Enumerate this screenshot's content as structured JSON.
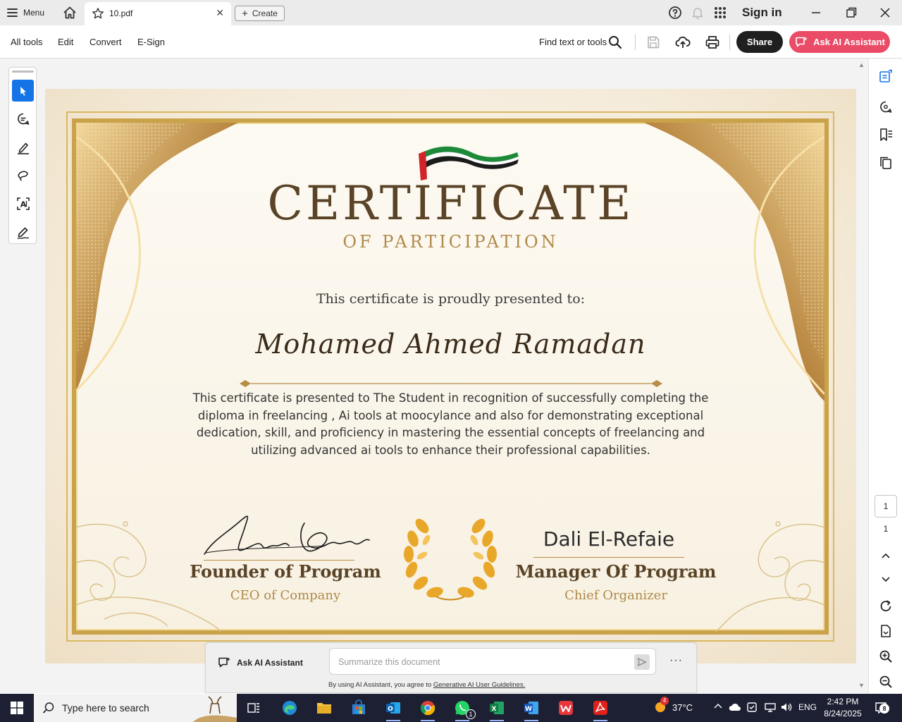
{
  "titlebar": {
    "menu_label": "Menu",
    "tab_name": "10.pdf",
    "tab_close": "✕",
    "create_label": "Create",
    "sign_in": "Sign in"
  },
  "toolbar": {
    "menus": [
      "All tools",
      "Edit",
      "Convert",
      "E-Sign"
    ],
    "find_label": "Find text or tools",
    "share_label": "Share",
    "ai_label": "Ask AI Assistant"
  },
  "certificate": {
    "title": "CERTIFICATE",
    "subtitle": "OF PARTICIPATION",
    "presented_to": "This certificate is proudly presented to:",
    "recipient": "Mohamed Ahmed Ramadan",
    "body": "This certificate is presented to The Student in recognition of successfully completing the diploma in freelancing , Ai tools at moocylance and also for demonstrating exceptional dedication, skill, and proficiency in mastering the essential concepts of freelancing and utilizing advanced ai tools to enhance their professional capabilities.",
    "signature_left": "Ahmed Emad",
    "role_left": "Founder of Program",
    "subrole_left": "CEO of Company",
    "manager_name": "Dali El-Refaie",
    "role_right": "Manager Of Program",
    "subrole_right": "Chief Organizer"
  },
  "right_rail": {
    "current_page": "1",
    "total_pages": "1"
  },
  "ai_assistant": {
    "label": "Ask AI Assistant",
    "placeholder": "Summarize this document",
    "more": "···",
    "disclaimer_prefix": "By using AI Assistant, you agree to ",
    "disclaimer_link": "Generative AI User Guidelines."
  },
  "taskbar": {
    "search_text": "Type here to search",
    "weather_badge": "4",
    "temperature": "37°C",
    "language": "ENG",
    "time": "2:42 PM",
    "date": "8/24/2025",
    "notification_count": "8",
    "whatsapp_badge": "1"
  },
  "colors": {
    "accent_blue": "#1473e6",
    "ai_pink": "#ea4b67",
    "gold": "#c9a24a",
    "title_brown": "#5a4326"
  },
  "icons": [
    "home-icon",
    "star-icon",
    "help-icon",
    "bell-icon",
    "apps-grid-icon",
    "search-icon",
    "save-icon",
    "upload-cloud-icon",
    "print-icon",
    "select-cursor-icon",
    "comment-icon",
    "highlight-pen-icon",
    "lasso-draw-icon",
    "text-recognition-icon",
    "sign-icon",
    "windows-start-icon"
  ]
}
